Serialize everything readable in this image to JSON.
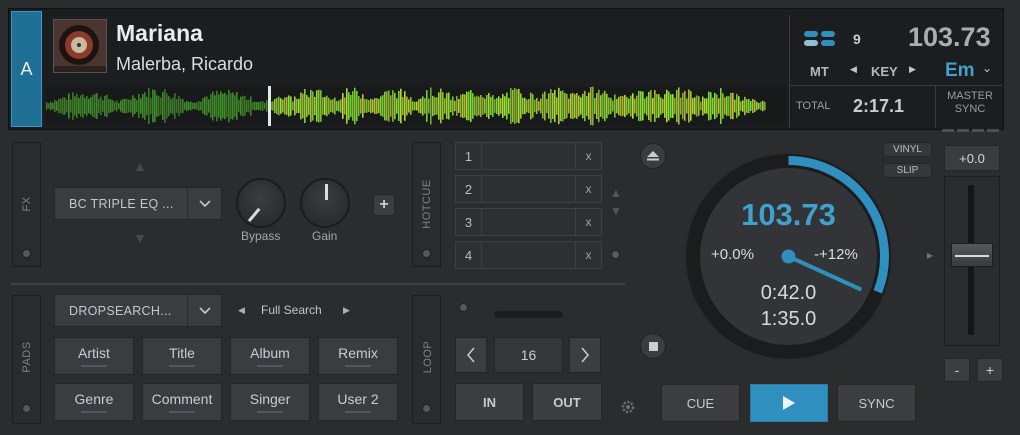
{
  "deck": {
    "letter": "A",
    "title": "Mariana",
    "artist": "Malerba, Ricardo",
    "bpm_top": "103.73",
    "key_label": "KEY",
    "key_value": "Em",
    "mt_label": "MT",
    "count": "9",
    "total_label": "TOTAL",
    "total_time": "2:17.1",
    "master_sync_line1": "MASTER",
    "master_sync_line2": "SYNC"
  },
  "fx": {
    "tab_label": "FX",
    "effect_name": "BC TRIPLE EQ ...",
    "knob1_label": "Bypass",
    "knob2_label": "Gain",
    "add_label": "+"
  },
  "hotcue": {
    "tab_label": "HOTCUE",
    "slots": [
      {
        "num": "1",
        "x": "x"
      },
      {
        "num": "2",
        "x": "x"
      },
      {
        "num": "3",
        "x": "x"
      },
      {
        "num": "4",
        "x": "x"
      }
    ]
  },
  "pads": {
    "tab_label": "PADS",
    "mode": "DROPSEARCH...",
    "search_mode": "Full Search",
    "buttons": [
      "Artist",
      "Title",
      "Album",
      "Remix",
      "Genre",
      "Comment",
      "Singer",
      "User 2"
    ]
  },
  "loop": {
    "tab_label": "LOOP",
    "size": "16",
    "in_label": "IN",
    "out_label": "OUT"
  },
  "jog": {
    "bpm": "103.73",
    "pitch": "+0.0%",
    "range": "-+12%",
    "elapsed": "0:42.0",
    "remaining": "1:35.0",
    "progress": 0.31
  },
  "pitch": {
    "value": "+0.0",
    "minus": "-",
    "plus": "+",
    "vinyl_label": "VINYL",
    "slip_label": "SLIP"
  },
  "transport": {
    "cue_label": "CUE",
    "play_icon": "play-icon",
    "sync_label": "SYNC"
  },
  "colors": {
    "accent": "#2f8fbe",
    "deck_tab": "#1f6f95",
    "waveform": "#7ddc3a"
  }
}
